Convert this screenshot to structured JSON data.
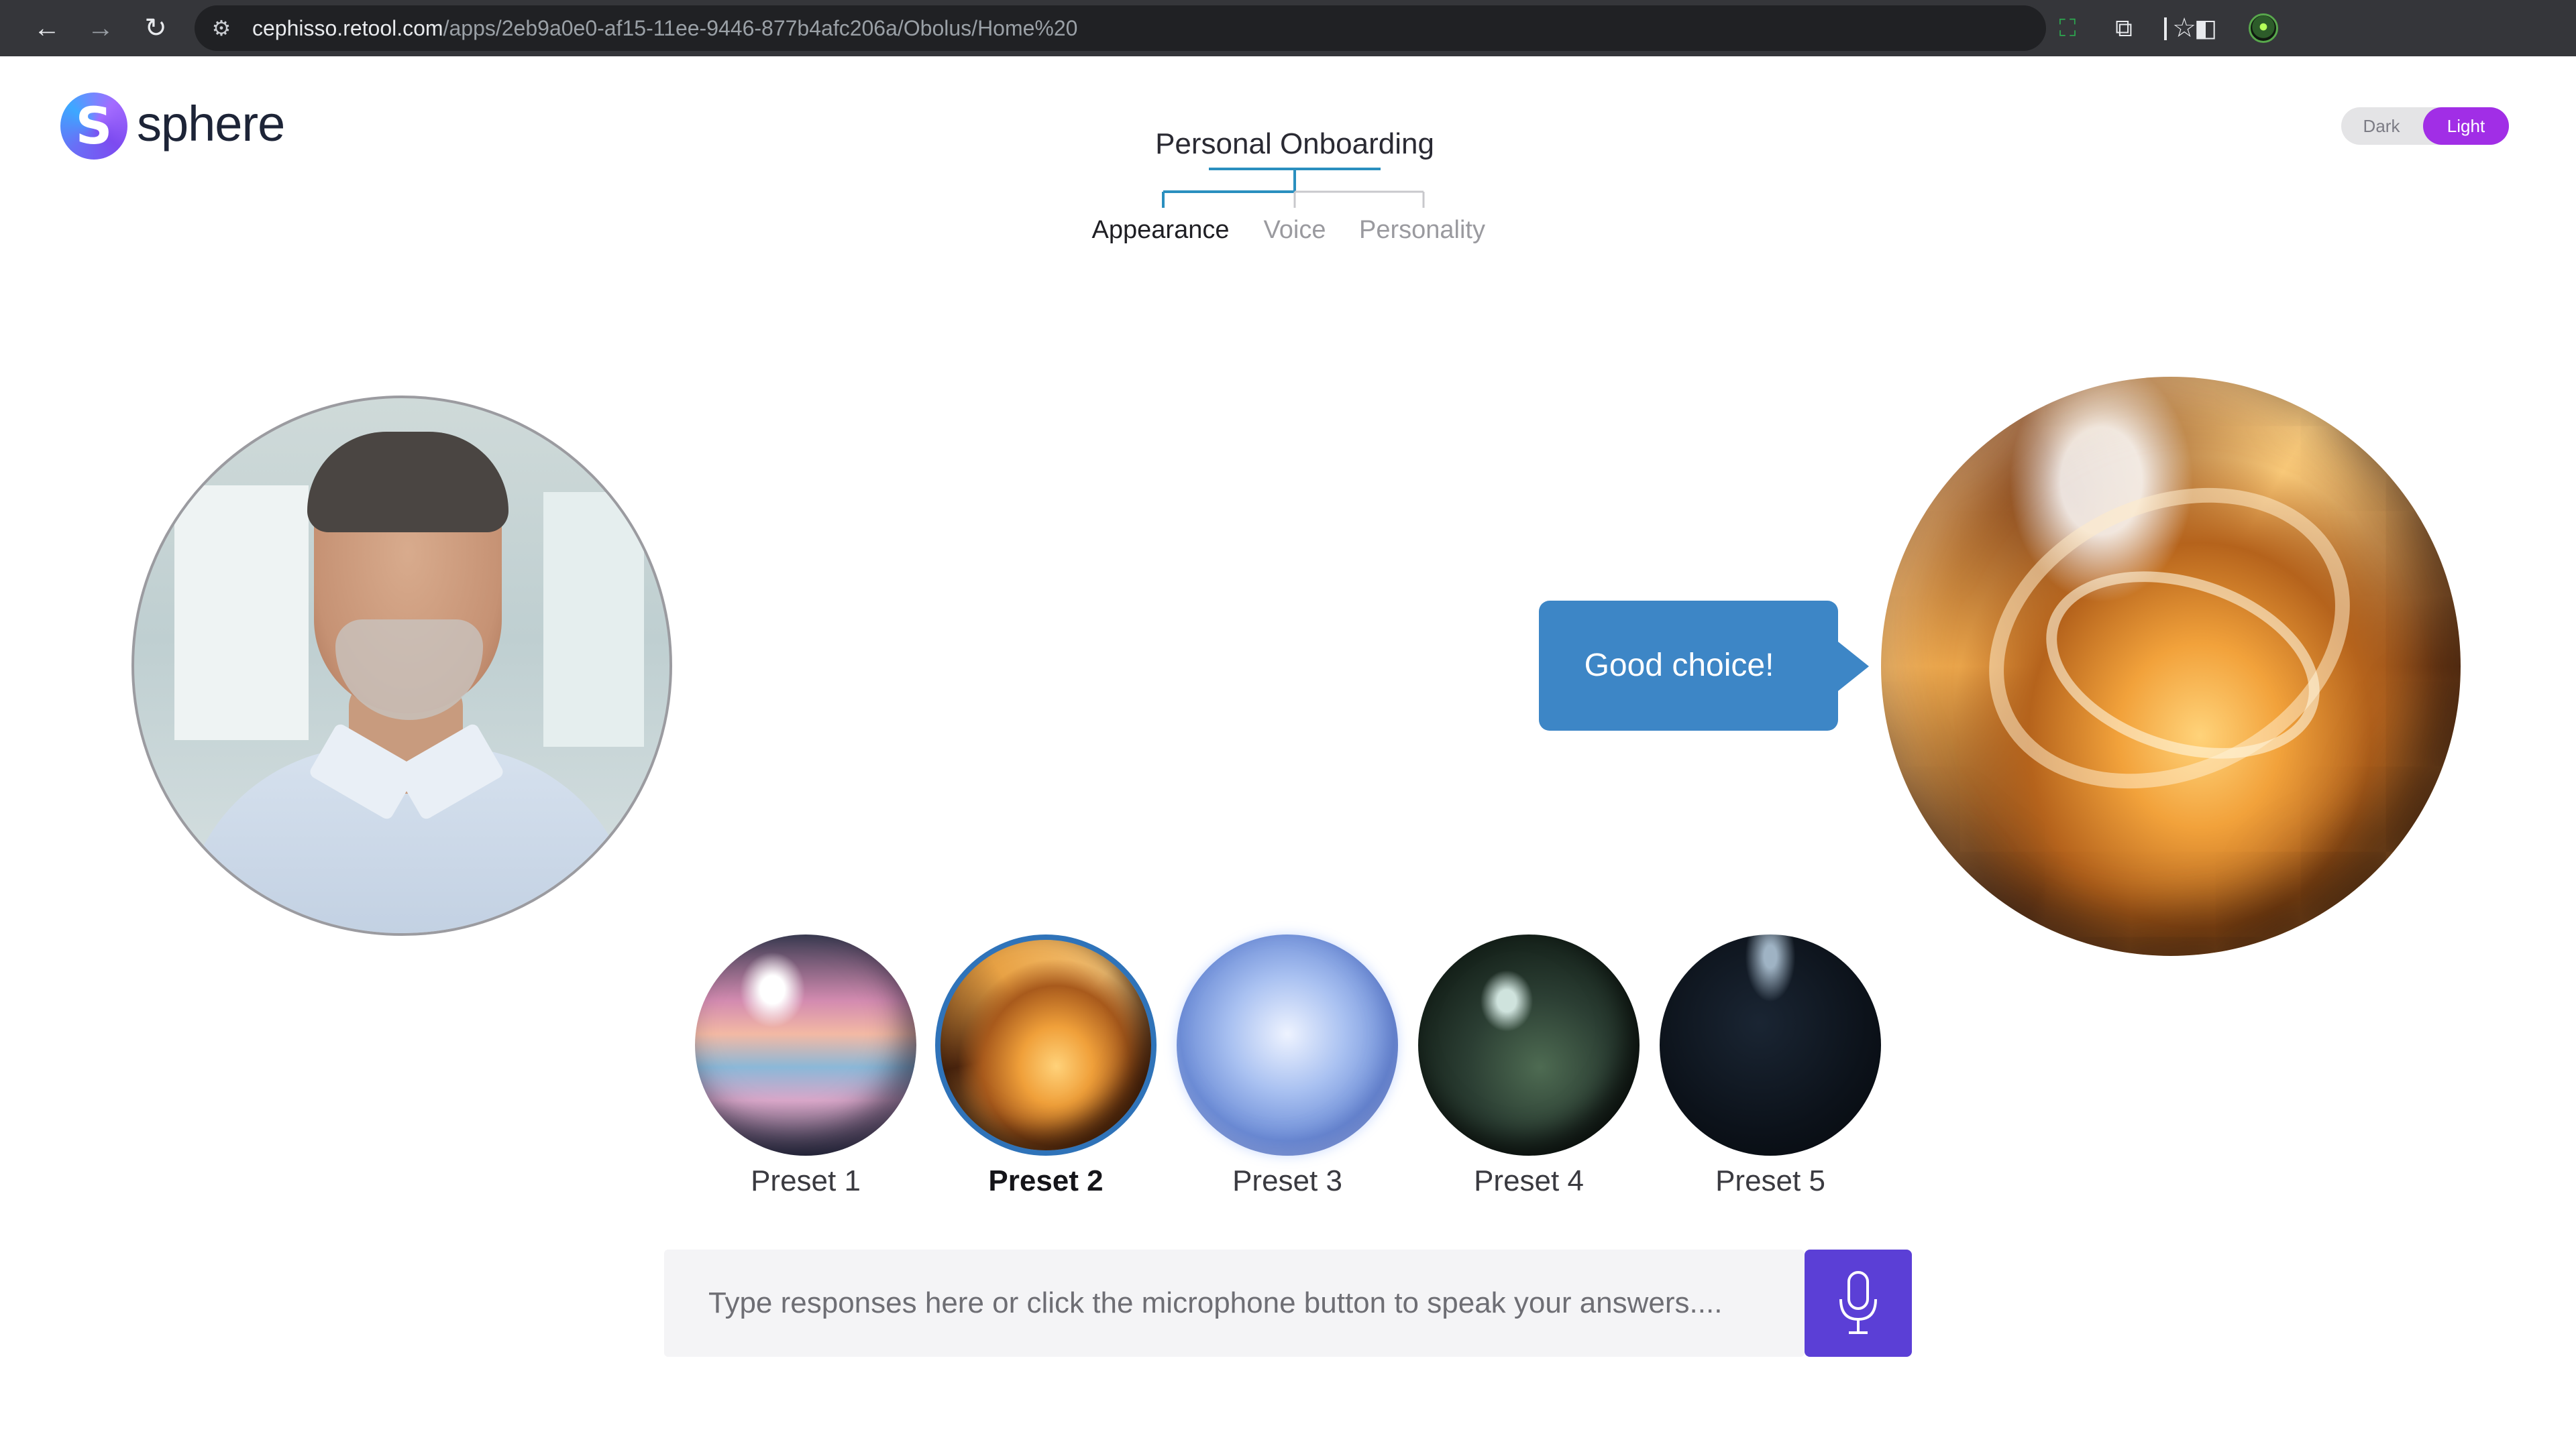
{
  "browser": {
    "url_host": "cephisso.retool.com",
    "url_path": "/apps/2eb9a0e0-af15-11ee-9446-877b4afc206a/Obolus/Home%20",
    "back_icon": "←",
    "forward_icon": "→",
    "reload_icon": "↻",
    "site_settings_icon": "⚙",
    "bookmark_icon": "☆",
    "extension_icon": "⧉",
    "sidepanel_icon": "◧",
    "screen_icon": "⛶"
  },
  "app": {
    "brand": "sphere",
    "logo_glyph": "S",
    "theme_toggle": {
      "dark_label": "Dark",
      "light_label": "Light",
      "selected": "Light"
    },
    "onboarding_title": "Personal Onboarding",
    "steps": [
      {
        "label": "Appearance",
        "active": true
      },
      {
        "label": "Voice",
        "active": false
      },
      {
        "label": "Personality",
        "active": false
      }
    ],
    "speech_bubble": "Good choice!",
    "presets": [
      {
        "label": "Preset 1",
        "selected": false
      },
      {
        "label": "Preset 2",
        "selected": true
      },
      {
        "label": "Preset 3",
        "selected": false
      },
      {
        "label": "Preset 4",
        "selected": false
      },
      {
        "label": "Preset 5",
        "selected": false
      }
    ],
    "input": {
      "value": "",
      "placeholder": "Type responses here or click the microphone button to speak your answers...."
    }
  },
  "colors": {
    "accent_purple": "#a12ee6",
    "bubble_blue": "#3d86c6",
    "mic_button": "#5b3fd6",
    "step_line": "#2a8fbf"
  }
}
